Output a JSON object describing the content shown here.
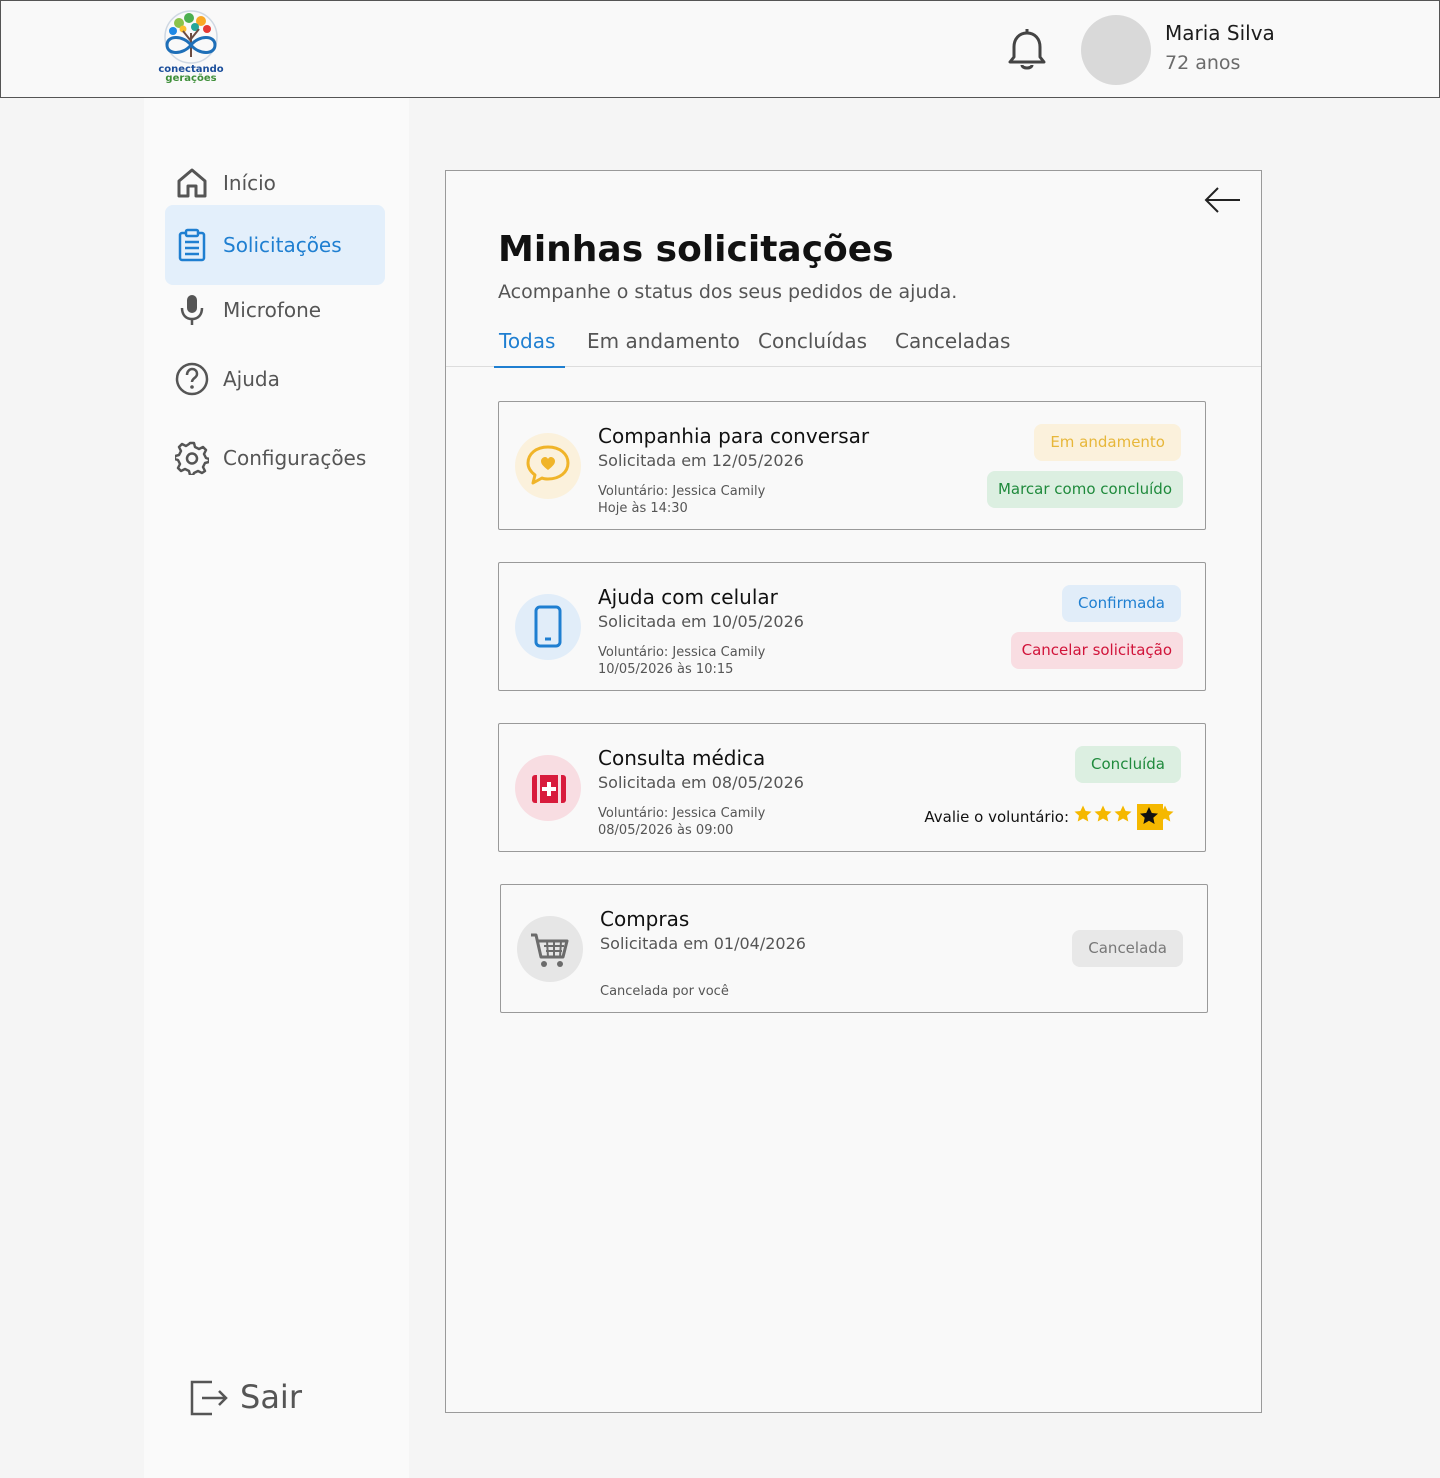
{
  "brand": {
    "logo_line1": "conectando",
    "logo_line2": "gerações",
    "primary_color": "#1f7fd1"
  },
  "header": {
    "user_name": "Maria Silva",
    "user_age": "72 anos",
    "notification_icon": "bell-icon"
  },
  "sidebar": {
    "items": [
      {
        "label": "Início",
        "icon": "home-icon",
        "active": false
      },
      {
        "label": "Solicitações",
        "icon": "clipboard-icon",
        "active": true
      },
      {
        "label": "Microfone",
        "icon": "microphone-icon",
        "active": false
      },
      {
        "label": "Ajuda",
        "icon": "help-icon",
        "active": false
      },
      {
        "label": "Configurações",
        "icon": "gear-icon",
        "active": false
      }
    ],
    "logout_label": "Sair"
  },
  "main": {
    "title": "Minhas solicitações",
    "subtitle": "Acompanhe o status dos seus pedidos de ajuda.",
    "tabs": [
      {
        "label": "Todas",
        "active": true
      },
      {
        "label": "Em andamento",
        "active": false
      },
      {
        "label": "Concluídas",
        "active": false
      },
      {
        "label": "Canceladas",
        "active": false
      }
    ],
    "requests": [
      {
        "title": "Companhia para conversar",
        "date": "Solicitada em 12/05/2026",
        "volunteer": "Voluntário: Jessica Camily",
        "time": "Hoje às 14:30",
        "icon": "chat-heart-icon",
        "status": "Em andamento",
        "action": "Marcar como concluído"
      },
      {
        "title": "Ajuda com celular",
        "date": "Solicitada em 10/05/2026",
        "volunteer": "Voluntário: Jessica Camily",
        "time": "10/05/2026 às 10:15",
        "icon": "phone-icon",
        "status": "Confirmada",
        "action": "Cancelar solicitação"
      },
      {
        "title": "Consulta médica",
        "date": "Solicitada em 08/05/2026",
        "volunteer": "Voluntário: Jessica Camily",
        "time": "08/05/2026 às 09:00",
        "icon": "medical-kit-icon",
        "status": "Concluída",
        "rating_label": "Avalie o voluntário:",
        "rating_max": 5
      },
      {
        "title": "Compras",
        "date": "Solicitada em 01/04/2026",
        "note": "Cancelada por você",
        "icon": "cart-icon",
        "status": "Cancelada"
      }
    ]
  }
}
